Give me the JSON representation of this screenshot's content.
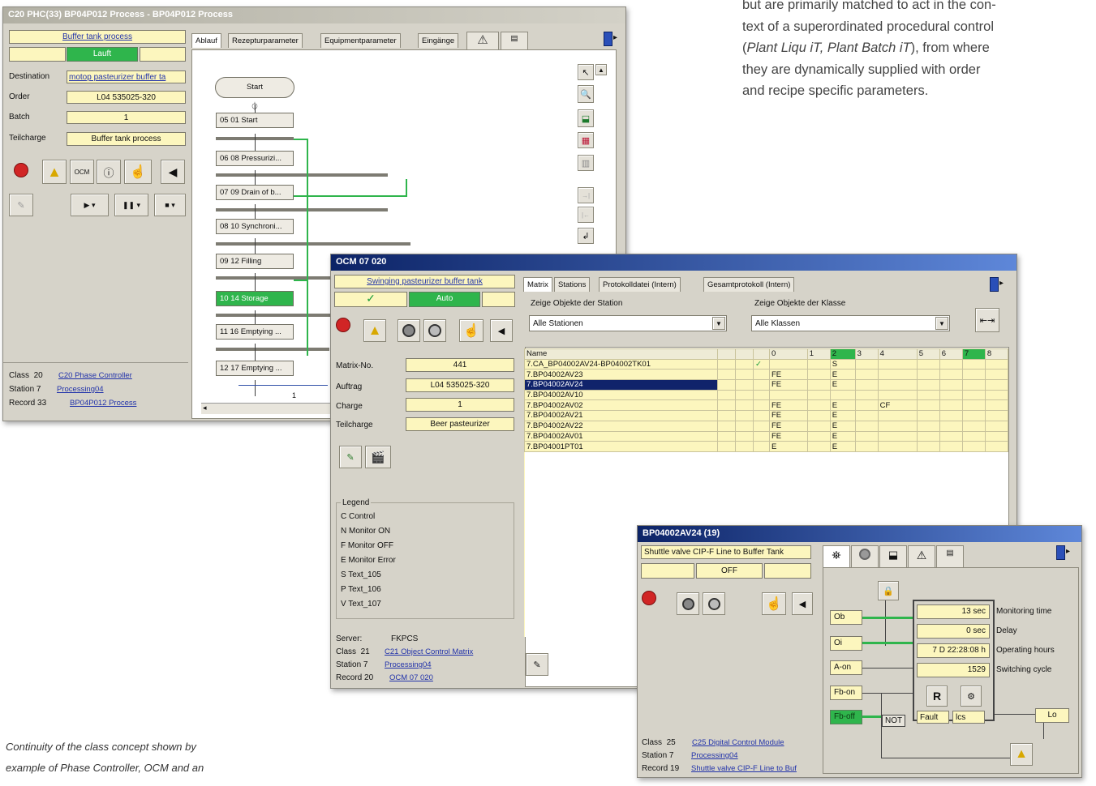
{
  "intro": {
    "line1": "but are primarily matched to act in the con-",
    "line2": "text of a superordinated procedural control",
    "line3": "(Plant Liqu iT, Plant Batch iT), from where",
    "line4": "they are dynamically supplied with order",
    "line5": "and recipe specific parameters."
  },
  "caption": {
    "line1": "Continuity of the class concept shown by",
    "line2": "example of Phase Controller, OCM and an"
  },
  "w1": {
    "title": "C20 PHC(33) BP04P012 Process - BP04P012 Process",
    "head": "Buffer tank process",
    "status": "Lauft",
    "dest_label": "Destination",
    "dest": "motop pasteurizer buffer ta",
    "order_label": "Order",
    "order": "L04 535025-320",
    "batch_label": "Batch",
    "batch": "1",
    "tc_label": "Teilcharge",
    "tc": "Buffer tank process",
    "ocm": "OCM",
    "tabs": [
      "Ablauf",
      "Rezepturparameter",
      "Equipmentparameter",
      "Eingänge"
    ],
    "steps": [
      "Start",
      "05 01 Start",
      "06 08 Pressurizi...",
      "07 09 Drain of b...",
      "08 10 Synchroni...",
      "09 12 Filling",
      "10 14 Storage",
      "11 16 Emptying ...",
      "12 17 Emptying ..."
    ],
    "step_val": "1",
    "class_label": "Class",
    "class_num": "20",
    "class_link": "C20 Phase Controller",
    "station_label": "Station",
    "station_num": "7",
    "station_link": "Processing04",
    "record_label": "Record",
    "record_num": "33",
    "record_link": "BP04P012 Process"
  },
  "w2": {
    "title": "OCM 07 020",
    "head": "Swinging pasteurizer buffer tank",
    "check": "✓",
    "status": "Auto",
    "mx_label": "Matrix-No.",
    "mx": "441",
    "auf_label": "Auftrag",
    "auf": "L04 535025-320",
    "ch_label": "Charge",
    "ch": "1",
    "tc_label": "Teilcharge",
    "tc": "Beer pasteurizer",
    "legend_title": "Legend",
    "legend": [
      "C  Control",
      "N  Monitor ON",
      "F  Monitor OFF",
      "E  Monitor Error",
      "S  Text_105",
      "P  Text_106",
      "V  Text_107"
    ],
    "server_label": "Server:",
    "server": "FKPCS",
    "class_label": "Class",
    "class_num": "21",
    "class_link": "C21 Object Control Matrix",
    "station_label": "Station",
    "station_num": "7",
    "station_link": "Processing04",
    "record_label": "Record",
    "record_num": "20",
    "record_link": "OCM 07 020",
    "tabs": [
      "Matrix",
      "Stations",
      "Protokolldatei (Intern)",
      "Gesamtprotokoll (Intern)"
    ],
    "st_label": "Zeige Objekte der Station",
    "st_value": "Alle Stationen",
    "cl_label": "Zeige Objekte der Klasse",
    "cl_value": "Alle Klassen",
    "grid_name": "Name",
    "grid_cols": [
      "0",
      "1",
      "2",
      "3",
      "4",
      "5",
      "6",
      "7",
      "8"
    ],
    "rows": [
      {
        "name": "7.CA_BP04002AV24-BP04002TK01",
        "chk": "✓",
        "cells": [
          "",
          "",
          "S",
          "",
          "",
          "",
          "",
          "",
          ""
        ]
      },
      {
        "name": "7.BP04002AV23",
        "chk": "",
        "cells": [
          "FE",
          "",
          "E",
          "",
          "",
          "",
          "",
          "",
          ""
        ]
      },
      {
        "name": "7.BP04002AV24",
        "chk": "",
        "cells": [
          "FE",
          "",
          "E",
          "",
          "",
          "",
          "",
          "",
          ""
        ]
      },
      {
        "name": "7.BP04002AV10",
        "chk": "",
        "cells": [
          "",
          "",
          "",
          "",
          "",
          "",
          "",
          "",
          ""
        ]
      },
      {
        "name": "7.BP04002AV02",
        "chk": "",
        "cells": [
          "FE",
          "",
          "E",
          "",
          "CF",
          "",
          "",
          "",
          ""
        ]
      },
      {
        "name": "7.BP04002AV21",
        "chk": "",
        "cells": [
          "FE",
          "",
          "E",
          "",
          "",
          "",
          "",
          "",
          ""
        ]
      },
      {
        "name": "7.BP04002AV22",
        "chk": "",
        "cells": [
          "FE",
          "",
          "E",
          "",
          "",
          "",
          "",
          "",
          ""
        ]
      },
      {
        "name": "7.BP04002AV01",
        "chk": "",
        "cells": [
          "FE",
          "",
          "E",
          "",
          "",
          "",
          "",
          "",
          ""
        ]
      },
      {
        "name": "7.BP04001PT01",
        "chk": "",
        "cells": [
          "E",
          "",
          "E",
          "",
          "",
          "",
          "",
          "",
          ""
        ]
      }
    ]
  },
  "w3": {
    "title": "BP04002AV24 (19)",
    "head": "Shuttle valve CIP-F Line to Buffer Tank",
    "status": "OFF",
    "labels": {
      "ob": "Ob",
      "oi": "Oi",
      "aon": "A-on",
      "fbon": "Fb-on",
      "fboff": "Fb-off",
      "not": "NOT",
      "r": "R",
      "fault": "Fault",
      "lcs": "lcs",
      "lo": "Lo"
    },
    "mon_val": "13 sec",
    "mon_label": "Monitoring time",
    "delay_val": "0 sec",
    "delay_label": "Delay",
    "op_val": "7 D 22:28:08 h",
    "op_label": "Operating hours",
    "sw_val": "1529",
    "sw_label": "Switching cycle",
    "class_label": "Class",
    "class_num": "25",
    "class_link": "C25 Digital Control Module",
    "station_label": "Station",
    "station_num": "7",
    "station_link": "Processing04",
    "record_label": "Record",
    "record_num": "19",
    "record_link": "Shuttle valve CIP-F Line to Buf"
  }
}
